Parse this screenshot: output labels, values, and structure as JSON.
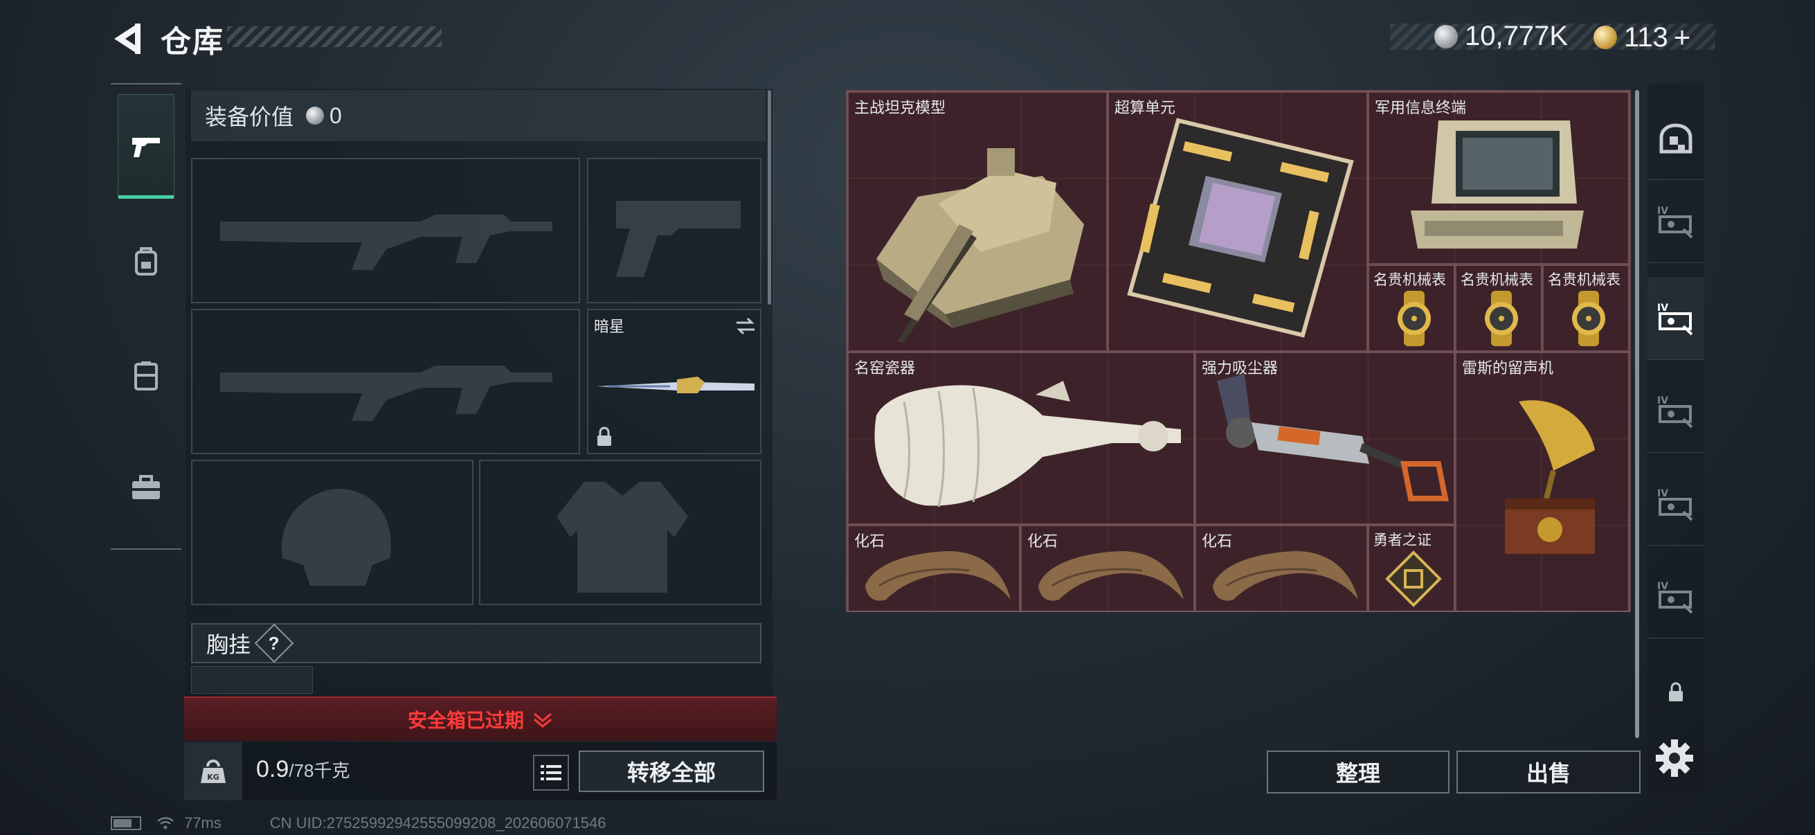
{
  "header": {
    "title": "仓库",
    "currency_silver": "10,777K",
    "currency_gold": "113",
    "currency_gold_plus": "+"
  },
  "left_nav": {
    "items": [
      "pistol-icon",
      "backpack-icon",
      "rig-icon",
      "toolbox-icon"
    ]
  },
  "equipment": {
    "value_label": "装备价值",
    "value": "0",
    "melee_name": "暗星",
    "chest_label": "胸挂",
    "chest_help": "?"
  },
  "safebox": {
    "status": "安全箱已过期"
  },
  "footer_left": {
    "weight_current": "0.9",
    "weight_max": "/78千克",
    "transfer_all": "转移全部"
  },
  "stash": {
    "items": [
      {
        "name": "主战坦克模型"
      },
      {
        "name": "超算单元"
      },
      {
        "name": "军用信息终端"
      },
      {
        "name": "名贵机械表"
      },
      {
        "name": "名贵机械表"
      },
      {
        "name": "名贵机械表"
      },
      {
        "name": "名窑瓷器"
      },
      {
        "name": "强力吸尘器"
      },
      {
        "name": "雷斯的留声机"
      },
      {
        "name": "化石"
      },
      {
        "name": "化石"
      },
      {
        "name": "化石"
      },
      {
        "name": "勇者之证"
      }
    ]
  },
  "actions": {
    "sort": "整理",
    "sell": "出售"
  },
  "status_bar": {
    "ping": "77ms",
    "uid": "CN UID:27525992942555099208_202606071546"
  },
  "colors": {
    "accent_green": "#48d0a2",
    "alert_red": "#ff3b3b",
    "grid_bg": "#3a2428"
  }
}
